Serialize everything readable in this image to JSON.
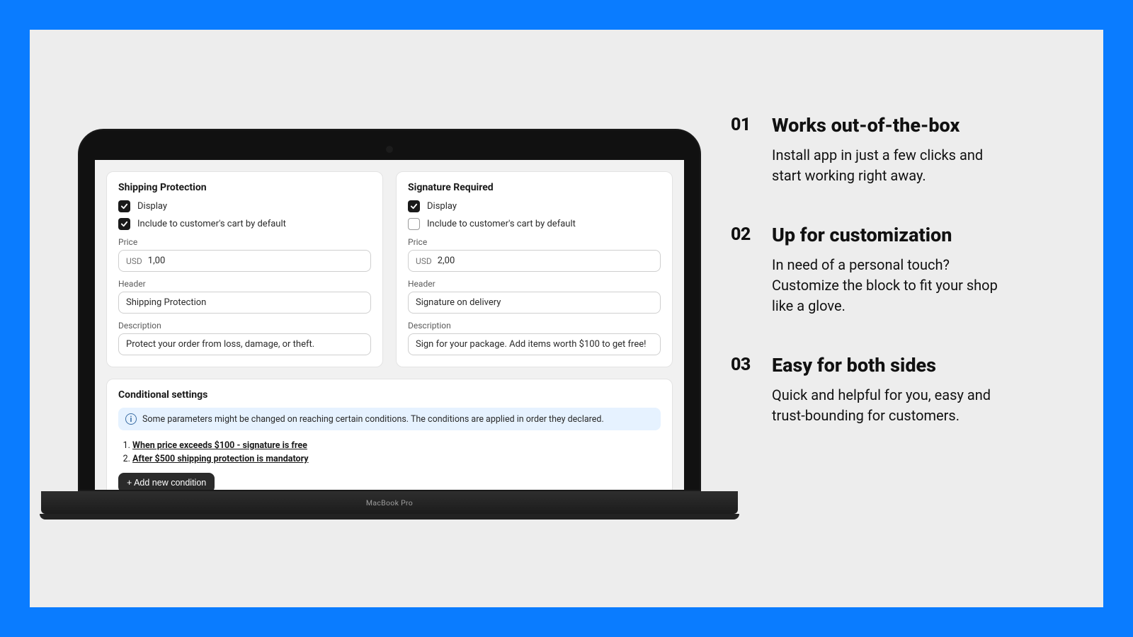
{
  "laptop_label": "MacBook Pro",
  "shipping": {
    "title": "Shipping Protection",
    "display_label": "Display",
    "display_checked": true,
    "include_label": "Include to customer's cart by default",
    "include_checked": true,
    "price_label": "Price",
    "currency": "USD",
    "price_value": "1,00",
    "header_label": "Header",
    "header_value": "Shipping Protection",
    "description_label": "Description",
    "description_value": "Protect your order from loss, damage, or theft."
  },
  "signature": {
    "title": "Signature Required",
    "display_label": "Display",
    "display_checked": true,
    "include_label": "Include to customer's cart by default",
    "include_checked": false,
    "price_label": "Price",
    "currency": "USD",
    "price_value": "2,00",
    "header_label": "Header",
    "header_value": "Signature on delivery",
    "description_label": "Description",
    "description_value": "Sign for your package. Add items worth $100 to get free!"
  },
  "conditional": {
    "title": "Conditional settings",
    "info_text": "Some parameters might be changed on reaching certain conditions. The conditions are applied in order they declared.",
    "condition_1": "When price exceeds $100 - signature is free",
    "condition_2": "After $500 shipping protection is mandatory",
    "add_button": "+ Add new condition"
  },
  "features": {
    "f1": {
      "num": "01",
      "title": "Works out-of-the-box",
      "body": "Install app in just a few clicks and start working right away."
    },
    "f2": {
      "num": "02",
      "title": "Up for customization",
      "body": "In need of a personal touch? Customize the block to fit your shop like a glove."
    },
    "f3": {
      "num": "03",
      "title": "Easy for both sides",
      "body": "Quick and helpful for you, easy and trust-bounding for customers."
    }
  }
}
